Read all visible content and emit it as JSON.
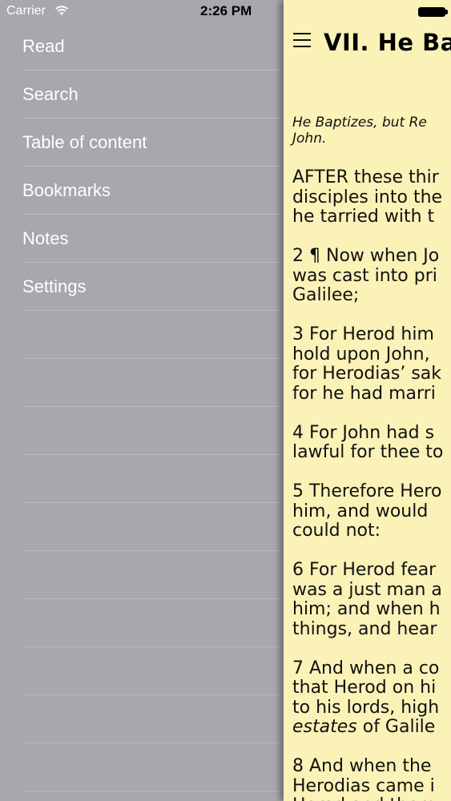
{
  "status_bar": {
    "carrier": "Carrier",
    "time": "2:26 PM"
  },
  "menu": {
    "items": [
      {
        "label": "Read"
      },
      {
        "label": "Search"
      },
      {
        "label": "Table of content"
      },
      {
        "label": "Bookmarks"
      },
      {
        "label": "Notes"
      },
      {
        "label": "Settings"
      }
    ]
  },
  "reader": {
    "title": "VII. He Ba",
    "summary_lines": [
      "He Baptizes, but Re",
      "John."
    ],
    "verses": [
      [
        "AFTER these thir",
        "disciples into the",
        "he tarried with t"
      ],
      [
        "2 ¶ Now when Jo",
        "was cast into pri",
        "Galilee;"
      ],
      [
        "3 For Herod him",
        "hold upon John,",
        "for Herodias’ sak",
        "for he had marri"
      ],
      [
        "4 For John had s",
        "lawful for thee to"
      ],
      [
        "5 Therefore Hero",
        "him, and would",
        "could not:"
      ],
      [
        "6 For Herod fear",
        "was a just man a",
        "him; and when h",
        "things, and hear"
      ],
      [
        "7 And when a co",
        "that Herod on hi",
        "to his lords, high",
        "estates of Galile"
      ],
      [
        "8 And when the",
        "Herodias came i",
        "Herod and them"
      ]
    ],
    "background_color": "#fbf2b8"
  }
}
